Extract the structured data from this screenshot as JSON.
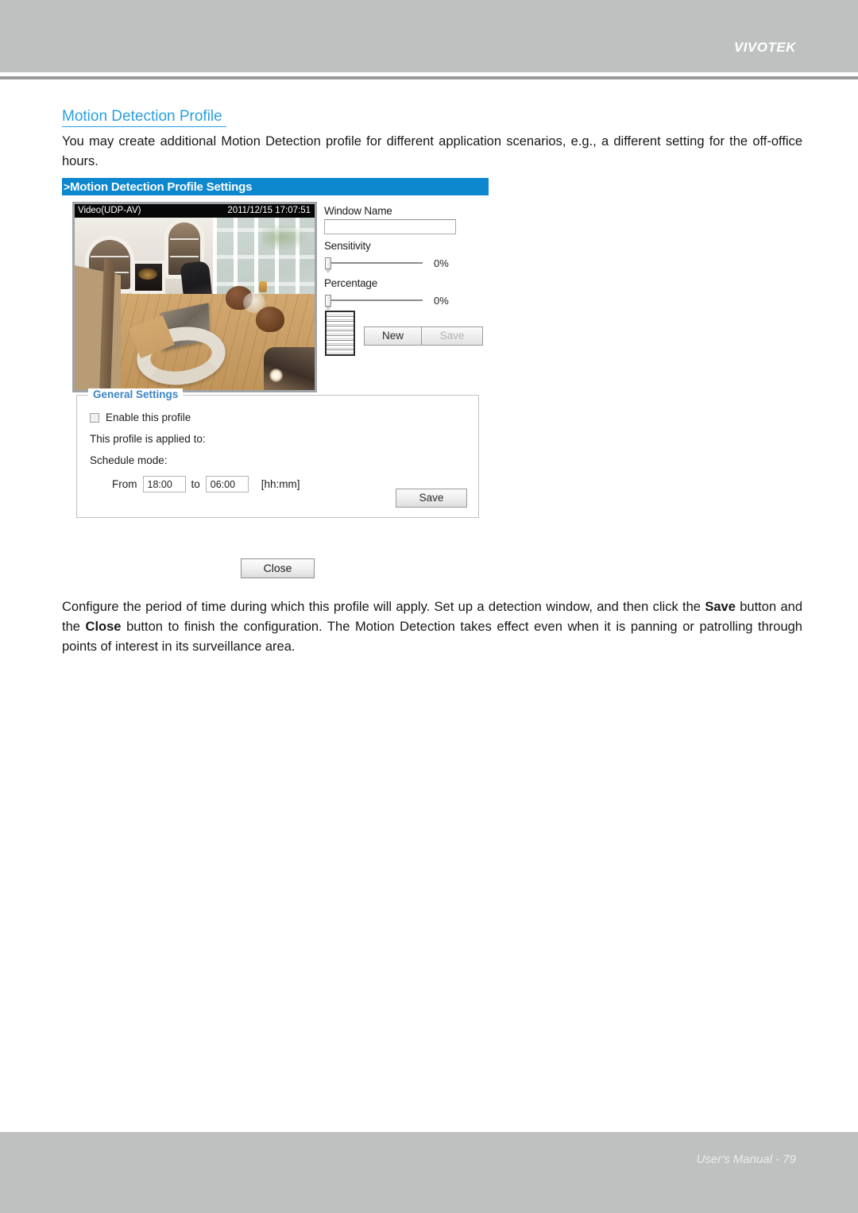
{
  "header": {
    "brand": "VIVOTEK"
  },
  "document": {
    "section_title": "Motion Detection Profile ",
    "intro_paragraph": "You may create additional Motion Detection profile for different application scenarios, e.g., a different setting for the off-office hours.",
    "closing_paragraph_part1": "Configure the period of time during which this profile will apply. Set up a detection window, and then click the ",
    "closing_bold1": "Save",
    "closing_paragraph_part2": " button and the ",
    "closing_bold2": "Close",
    "closing_paragraph_part3": " button to finish the configuration. The Motion Detection takes effect even when it is panning or patrolling through points of interest in its surveillance area."
  },
  "settings_panel": {
    "bar_caret": ">",
    "bar_title": "Motion Detection Profile Settings",
    "video": {
      "stream_label": "Video(UDP-AV)",
      "timestamp": "2011/12/15 17:07:51"
    },
    "form": {
      "window_name_label": "Window Name",
      "window_name_value": "",
      "window_name_placeholder": "",
      "sensitivity_label": "Sensitivity",
      "sensitivity_value": "0%",
      "percentage_label": "Percentage",
      "percentage_value": "0%",
      "new_button": "New",
      "save_button": "Save"
    }
  },
  "general_settings": {
    "legend": "General Settings",
    "enable_checkbox_label": "Enable this profile",
    "enable_checked": false,
    "applied_to_label": "This profile is applied to:",
    "schedule_mode_label": "Schedule mode:",
    "from_label": "From",
    "from_value": "18:00",
    "to_label": "to",
    "to_value": "06:00",
    "format_hint": "[hh:mm]",
    "save_button": "Save"
  },
  "close_button": "Close",
  "footer": {
    "text": "User's Manual - 79"
  },
  "colors": {
    "accent_blue": "#0d87cd",
    "link_blue": "#2aa0e0",
    "legend_blue": "#3d83c4",
    "chrome_gray": "#bfc1c1"
  }
}
